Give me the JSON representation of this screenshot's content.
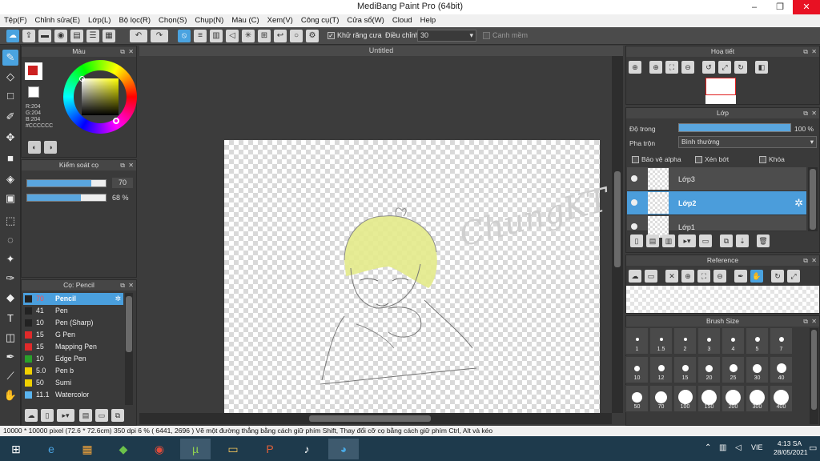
{
  "window": {
    "title": "MediBang Paint Pro (64bit)",
    "minimize": "–",
    "maximize": "❐",
    "close": "✕"
  },
  "menu": [
    "Tệp(F)",
    "Chỉnh sửa(E)",
    "Lớp(L)",
    "Bộ lọc(R)",
    "Chọn(S)",
    "Chụp(N)",
    "Màu (C)",
    "Xem(V)",
    "Công cụ(T)",
    "Cửa sổ(W)",
    "Cloud",
    "Help"
  ],
  "toolbar": {
    "antialias_label": "Khử răng cưa",
    "antialias_checked": true,
    "adjust_label": "Điều chỉnh",
    "adjust_value": "30",
    "smooth_label": "Canh mềm",
    "smooth_checked": false
  },
  "color_panel": {
    "title": "Màu",
    "r": "R:204",
    "g": "G:204",
    "b": "B:204",
    "hex": "#CCCCCC",
    "primary": "#cc2020",
    "secondary": "#ffffff"
  },
  "brush_control": {
    "title": "Kiểm soát cọ",
    "size_value": "70",
    "size_fill": 0.82,
    "opacity_value": "68 %",
    "opacity_fill": 0.68
  },
  "brush_panel": {
    "title": "Cọ: Pencil",
    "items": [
      {
        "size": "70",
        "name": "Pencil",
        "color": "#222222",
        "selected": true
      },
      {
        "size": "41",
        "name": "Pen",
        "color": "#222222"
      },
      {
        "size": "10",
        "name": "Pen (Sharp)",
        "color": "#222222"
      },
      {
        "size": "15",
        "name": "G Pen",
        "color": "#e02a2a"
      },
      {
        "size": "15",
        "name": "Mapping Pen",
        "color": "#e02a2a"
      },
      {
        "size": "10",
        "name": "Edge Pen",
        "color": "#2aa02a"
      },
      {
        "size": "5.0",
        "name": "Pen b",
        "color": "#f0d000"
      },
      {
        "size": "50",
        "name": "Sumi",
        "color": "#f0d000"
      },
      {
        "size": "11.1",
        "name": "Watercolor",
        "color": "#5ab4ee"
      }
    ]
  },
  "canvas": {
    "tab_title": "Untitled",
    "watermark": "ChungKT"
  },
  "navigator": {
    "title": "Hoạ tiết"
  },
  "layer_panel": {
    "title": "Lớp",
    "opacity_label": "Độ trong",
    "opacity_value": "100 %",
    "opacity_fill": 1.0,
    "blend_label": "Pha trộn",
    "blend_value": "Bình thường",
    "protect_alpha": "Bảo vệ alpha",
    "clipping": "Xén bớt",
    "lock": "Khóa",
    "layers": [
      {
        "name": "Lớp3",
        "selected": false
      },
      {
        "name": "Lớp2",
        "selected": true
      },
      {
        "name": "Lớp1",
        "selected": false
      }
    ]
  },
  "reference_panel": {
    "title": "Reference"
  },
  "brush_size_panel": {
    "title": "Brush Size",
    "sizes": [
      "1",
      "1.5",
      "2",
      "3",
      "4",
      "5",
      "7",
      "10",
      "12",
      "15",
      "20",
      "25",
      "30",
      "40",
      "50",
      "70",
      "100",
      "150",
      "200",
      "300",
      "400"
    ]
  },
  "status": {
    "text": "10000 * 10000 pixel   (72.6 * 72.6cm)   350 dpi   6 %   ( 6441, 2696 )   Vẽ một đường thẳng bằng cách giữ phím Shift, Thay đổi cỡ cọ bằng cách giữ phím Ctrl, Alt và kéo"
  },
  "taskbar": {
    "lang": "VIE",
    "time": "4:13 SA",
    "date": "28/05/2021"
  }
}
